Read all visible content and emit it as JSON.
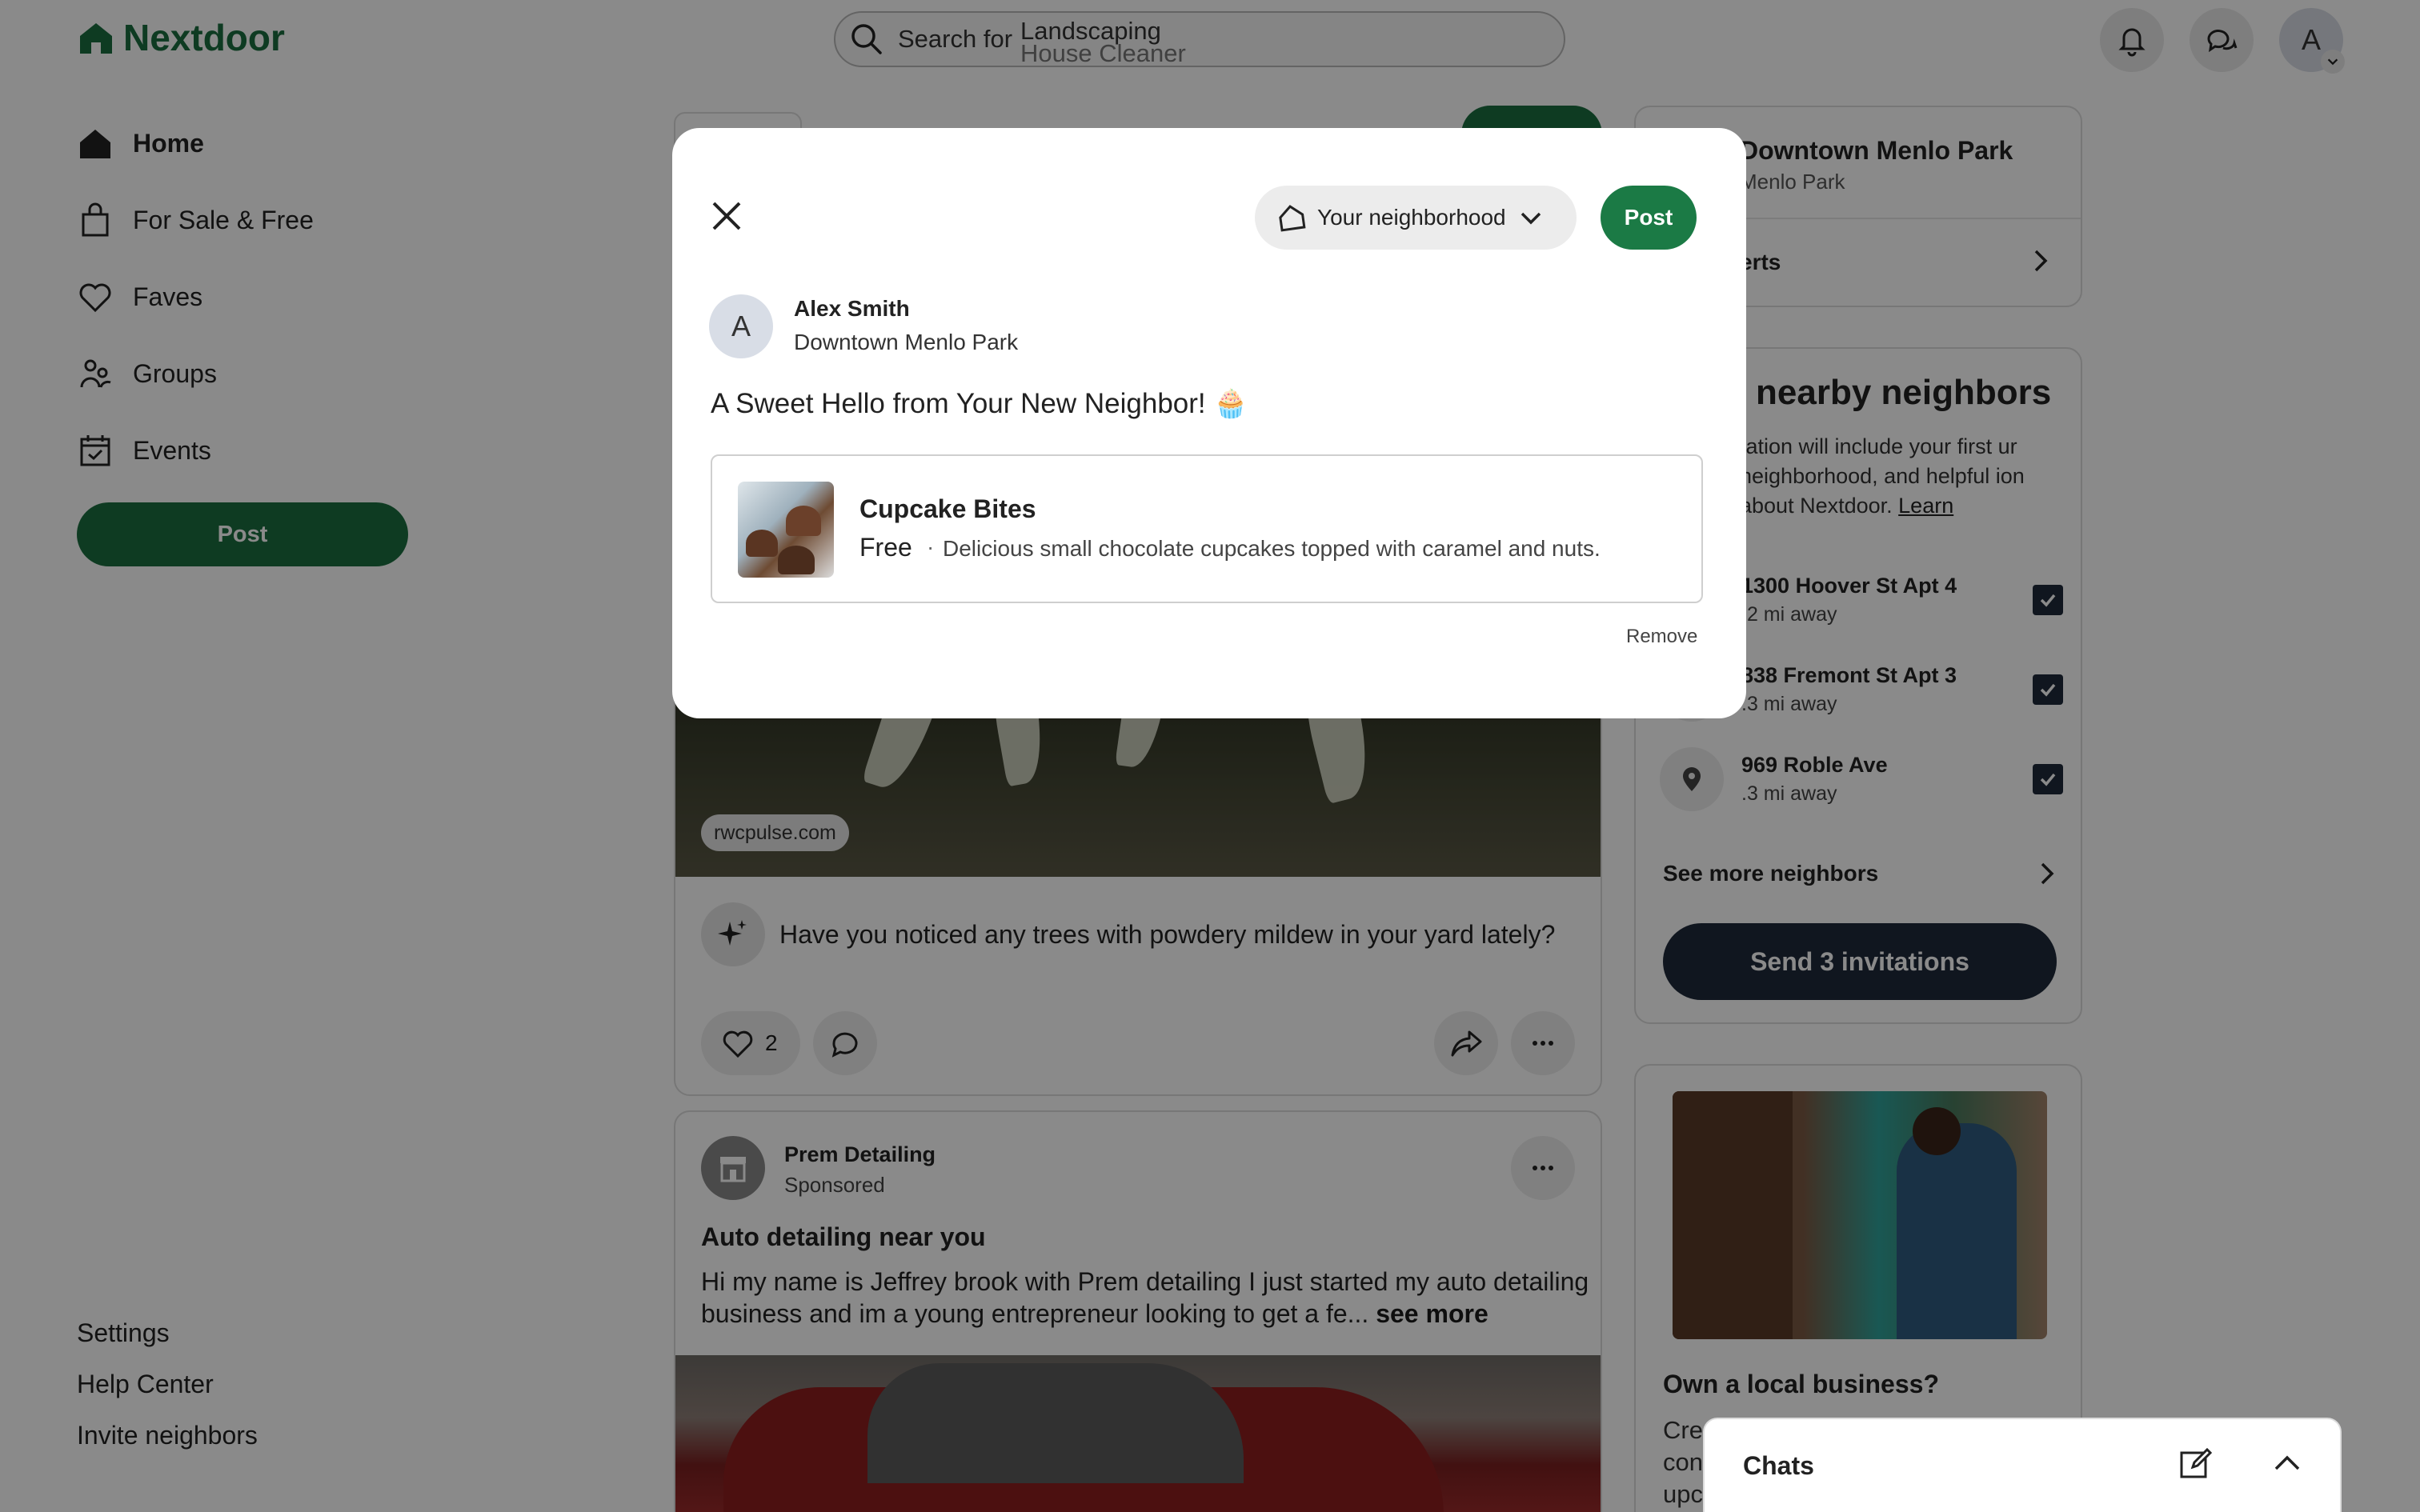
{
  "brand": {
    "name": "Nextdoor",
    "color": "#1b6e3f"
  },
  "header": {
    "search_label": "Search for",
    "search_suggestions": [
      "Landscaping",
      "House Cleaner"
    ],
    "user_initial": "A"
  },
  "sidebar": {
    "items": [
      {
        "label": "Home",
        "icon": "house-icon",
        "active": true
      },
      {
        "label": "For Sale & Free",
        "icon": "shopping-bag-icon",
        "active": false
      },
      {
        "label": "Faves",
        "icon": "heart-icon",
        "active": false
      },
      {
        "label": "Groups",
        "icon": "groups-icon",
        "active": false
      },
      {
        "label": "Events",
        "icon": "calendar-icon",
        "active": false
      }
    ],
    "post_label": "Post",
    "footer_links": [
      "Settings",
      "Help Center",
      "Invite neighbors"
    ]
  },
  "feed": {
    "post1": {
      "source": "rwcpulse.com",
      "prompt": "Have you noticed any trees with powdery mildew in your yard lately?",
      "likes": "2"
    },
    "ad": {
      "business": "Prem Detailing",
      "sponsored": "Sponsored",
      "title": "Auto detailing near you",
      "body": "Hi my name is Jeffrey brook with Prem detailing I just started my auto detailing business and im a young entrepreneur looking to get a fe...",
      "see_more": "see more"
    }
  },
  "right": {
    "neighborhood": {
      "title": "Downtown Menlo Park",
      "subtitle": "Menlo Park",
      "alerts_label": "erts"
    },
    "invite": {
      "heading": "nearby neighbors",
      "text": "tation will include your first ur neighborhood, and helpful ion about Nextdoor.",
      "learn": "Learn",
      "neighbors": [
        {
          "address": "1300 Hoover St Apt 4",
          "distance": ".2 mi away",
          "checked": true
        },
        {
          "address": "838 Fremont St Apt 3",
          "distance": ".3 mi away",
          "checked": true
        },
        {
          "address": "969 Roble Ave",
          "distance": ".3 mi away",
          "checked": true
        }
      ],
      "see_more": "See more neighbors",
      "send_label": "Send 3 invitations"
    },
    "business": {
      "question": "Own a local business?",
      "text_lines": [
        "Cre",
        "con",
        "upc"
      ]
    }
  },
  "chats": {
    "title": "Chats"
  },
  "modal": {
    "audience": "Your neighborhood",
    "post_label": "Post",
    "author": {
      "initial": "A",
      "name": "Alex Smith",
      "location": "Downtown Menlo Park"
    },
    "text": "A Sweet Hello from Your New Neighbor! 🧁",
    "attachment": {
      "title": "Cupcake Bites",
      "price": "Free",
      "separator": "·",
      "description": "Delicious small chocolate cupcakes topped with caramel and nuts."
    },
    "remove_label": "Remove"
  }
}
